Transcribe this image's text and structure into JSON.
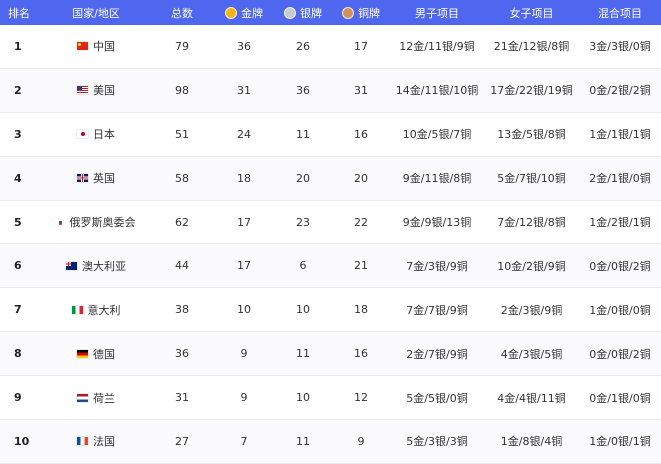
{
  "header": {
    "rank": "排名",
    "country": "国家/地区",
    "total": "总数",
    "gold": "金牌",
    "silver": "银牌",
    "bronze": "铜牌",
    "men": "男子项目",
    "women": "女子项目",
    "mixed": "混合项目"
  },
  "colors": {
    "header_bg": "#4f67ee",
    "gold": "#f4b31b",
    "silver": "#c8cbd6",
    "bronze": "#d29062"
  },
  "rows": [
    {
      "rank": "1",
      "flag": "cn",
      "country": "中国",
      "total": "79",
      "gold": "36",
      "silver": "26",
      "bronze": "17",
      "men": "12金/11银/9铜",
      "women": "21金/12银/8铜",
      "mixed": "3金/3银/0铜"
    },
    {
      "rank": "2",
      "flag": "us",
      "country": "美国",
      "total": "98",
      "gold": "31",
      "silver": "36",
      "bronze": "31",
      "men": "14金/11银/10铜",
      "women": "17金/22银/19铜",
      "mixed": "0金/2银/2铜"
    },
    {
      "rank": "3",
      "flag": "jp",
      "country": "日本",
      "total": "51",
      "gold": "24",
      "silver": "11",
      "bronze": "16",
      "men": "10金/5银/7铜",
      "women": "13金/5银/8铜",
      "mixed": "1金/1银/1铜"
    },
    {
      "rank": "4",
      "flag": "gb",
      "country": "英国",
      "total": "58",
      "gold": "18",
      "silver": "20",
      "bronze": "20",
      "men": "9金/11银/8铜",
      "women": "5金/7银/10铜",
      "mixed": "2金/1银/0铜"
    },
    {
      "rank": "5",
      "flag": "roc",
      "country": "俄罗斯奥委会",
      "total": "62",
      "gold": "17",
      "silver": "23",
      "bronze": "22",
      "men": "9金/9银/13铜",
      "women": "7金/12银/8铜",
      "mixed": "1金/2银/1铜"
    },
    {
      "rank": "6",
      "flag": "au",
      "country": "澳大利亚",
      "total": "44",
      "gold": "17",
      "silver": "6",
      "bronze": "21",
      "men": "7金/3银/9铜",
      "women": "10金/2银/9铜",
      "mixed": "0金/0银/2铜"
    },
    {
      "rank": "7",
      "flag": "it",
      "country": "意大利",
      "total": "38",
      "gold": "10",
      "silver": "10",
      "bronze": "18",
      "men": "7金/7银/9铜",
      "women": "2金/3银/9铜",
      "mixed": "1金/0银/0铜"
    },
    {
      "rank": "8",
      "flag": "de",
      "country": "德国",
      "total": "36",
      "gold": "9",
      "silver": "11",
      "bronze": "16",
      "men": "2金/7银/9铜",
      "women": "4金/3银/5铜",
      "mixed": "0金/0银/2铜"
    },
    {
      "rank": "9",
      "flag": "nl",
      "country": "荷兰",
      "total": "31",
      "gold": "9",
      "silver": "10",
      "bronze": "12",
      "men": "5金/5银/0铜",
      "women": "4金/4银/11铜",
      "mixed": "0金/1银/0铜"
    },
    {
      "rank": "10",
      "flag": "fr",
      "country": "法国",
      "total": "27",
      "gold": "7",
      "silver": "11",
      "bronze": "9",
      "men": "5金/3银/3铜",
      "women": "1金/8银/4铜",
      "mixed": "1金/0银/1铜"
    }
  ]
}
